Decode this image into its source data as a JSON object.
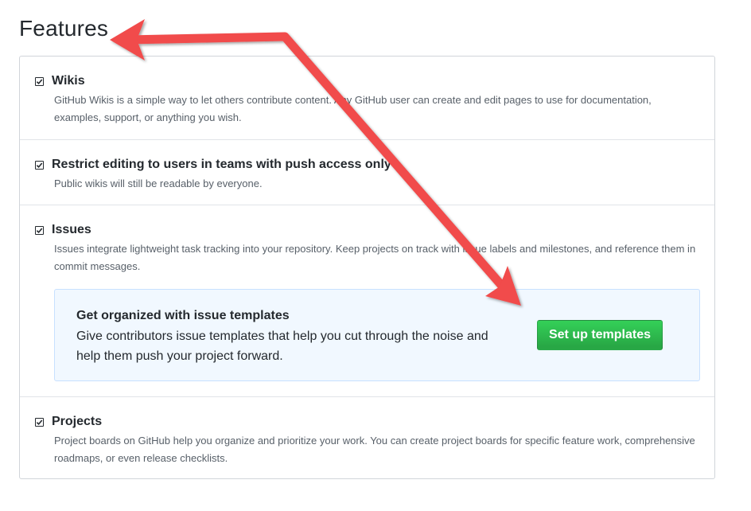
{
  "section_title": "Features",
  "features": [
    {
      "title": "Wikis",
      "description": "GitHub Wikis is a simple way to let others contribute content. Any GitHub user can create and edit pages to use for documentation, examples, support, or anything you wish.",
      "checked": true
    },
    {
      "title": "Restrict editing to users in teams with push access only",
      "description": "Public wikis will still be readable by everyone.",
      "checked": true
    },
    {
      "title": "Issues",
      "description": "Issues integrate lightweight task tracking into your repository. Keep projects on track with issue labels and milestones, and reference them in commit messages.",
      "checked": true
    },
    {
      "title": "Projects",
      "description": "Project boards on GitHub help you organize and prioritize your work. You can create project boards for specific feature work, comprehensive roadmaps, or even release checklists.",
      "checked": true
    }
  ],
  "issue_templates_callout": {
    "title": "Get organized with issue templates",
    "body": "Give contributors issue templates that help you cut through the noise and help them push your project forward.",
    "button_label": "Set up templates"
  },
  "colors": {
    "button_green": "#28a745",
    "callout_bg": "#f1f8ff",
    "annotation_red": "#f14b4b"
  }
}
